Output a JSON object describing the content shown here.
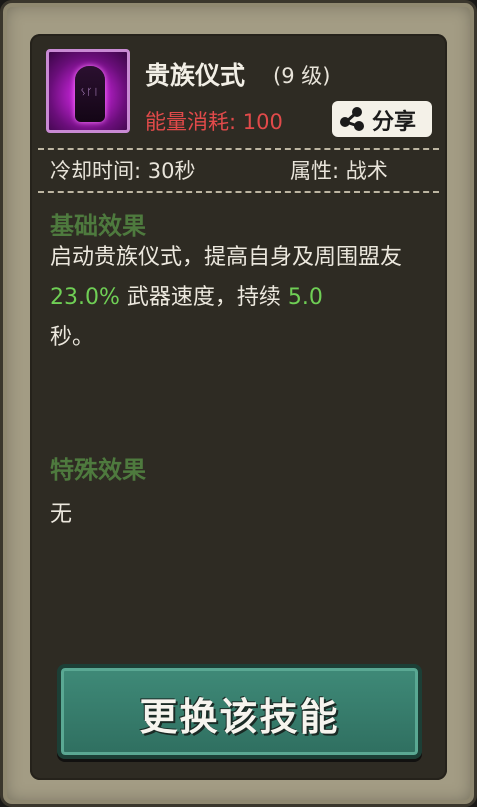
{
  "skill": {
    "icon": "ritual-stone-icon",
    "name": "贵族仪式",
    "level": "(9 级)",
    "energy_cost": "能量消耗: 100",
    "cooldown": "冷却时间: 30秒",
    "attribute": "属性: 战术"
  },
  "share": {
    "icon": "share-icon",
    "label": "分享"
  },
  "base_effect": {
    "title": "基础效果",
    "text_1": "启动贵族仪式，提高自身及周围盟友 ",
    "value_1": "23.0%",
    "text_2": " 武器速度，持续 ",
    "value_2": "5.0",
    "text_3": "秒。"
  },
  "special_effect": {
    "title": "特殊效果",
    "text": "无"
  },
  "action": {
    "change_label": "更换该技能"
  },
  "colors": {
    "energy": "#e14a4a",
    "section_title": "#4e7a3e",
    "highlight": "#6fcf55",
    "button": "#3f8a78"
  }
}
